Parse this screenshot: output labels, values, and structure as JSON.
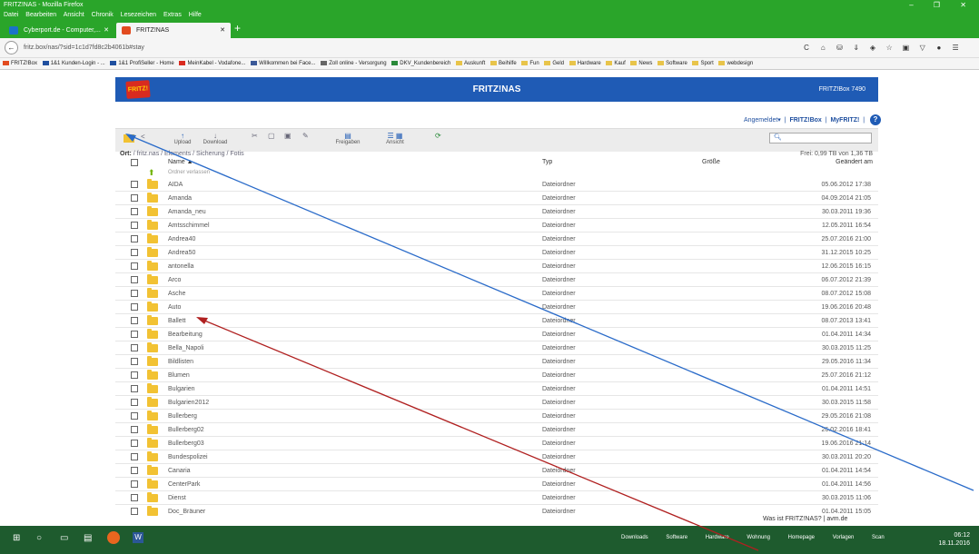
{
  "window": {
    "title": "FRITZ!NAS - Mozilla Firefox",
    "controls": "–  ❐  ✕"
  },
  "menu": [
    "Datei",
    "Bearbeiten",
    "Ansicht",
    "Chronik",
    "Lesezeichen",
    "Extras",
    "Hilfe"
  ],
  "tabs": [
    {
      "label": "Cyberport.de - Computer,...",
      "close": "✕"
    },
    {
      "label": "FRITZ!NAS",
      "close": "✕"
    }
  ],
  "new_tab": "+",
  "nav": {
    "url": "fritz.box/nas/?sid=1c1d7fd8c2b4061b#stay",
    "back": "←",
    "icons": [
      "C",
      "⌂",
      "⛁",
      "⇓",
      "◈",
      "☆",
      "▣",
      "▽",
      "●",
      "☰"
    ]
  },
  "bookmarks": [
    "FRITZ!Box",
    "1&1 Kunden-Login - ...",
    "1&1 ProfiSeller - Home",
    "MeinKabel - Vodafone...",
    "Willkommen bei Face...",
    "Zoll online - Versorgung",
    "DKV_Kundenbereich",
    "Auskunft",
    "Beihilfe",
    "Fun",
    "Geld",
    "Hardware",
    "Kauf",
    "News",
    "Software",
    "Sport",
    "webdesign"
  ],
  "fritz": {
    "logo": "FRITZ!",
    "title": "FRITZ!NAS",
    "model": "FRITZ!Box 7490",
    "links": {
      "logged": "Angemeldet▾",
      "sep": "|",
      "fritzbox": "FRITZ!Box",
      "myfritz": "MyFRITZ!",
      "help": "?"
    }
  },
  "toolbar": {
    "upload": "Upload",
    "download": "Download",
    "freigaben": "Freigaben",
    "ansicht": "Ansicht",
    "search_placeholder": ""
  },
  "path": {
    "label": "Ort:",
    "value": "/ fritz.nas / Elements / Sicherung / Fotis",
    "free": "Frei: 0,99 TB von 1,36 TB"
  },
  "columns": {
    "name": "Name ▲",
    "type": "Typ",
    "size": "Größe",
    "date": "Geändert am"
  },
  "up_label": "Ordner verlassen",
  "rows": [
    {
      "name": "AIDA",
      "type": "Dateiordner",
      "date": "05.06.2012 17:38"
    },
    {
      "name": "Amanda",
      "type": "Dateiordner",
      "date": "04.09.2014 21:05"
    },
    {
      "name": "Amanda_neu",
      "type": "Dateiordner",
      "date": "30.03.2011 19:36"
    },
    {
      "name": "Amtsschimmel",
      "type": "Dateiordner",
      "date": "12.05.2011 16:54"
    },
    {
      "name": "Andrea40",
      "type": "Dateiordner",
      "date": "25.07.2016 21:00"
    },
    {
      "name": "Andrea50",
      "type": "Dateiordner",
      "date": "31.12.2015 10:25"
    },
    {
      "name": "antonella",
      "type": "Dateiordner",
      "date": "12.06.2015 16:15"
    },
    {
      "name": "Arco",
      "type": "Dateiordner",
      "date": "06.07.2012 21:39"
    },
    {
      "name": "Asche",
      "type": "Dateiordner",
      "date": "08.07.2012 15:08"
    },
    {
      "name": "Auto",
      "type": "Dateiordner",
      "date": "19.06.2016 20:48"
    },
    {
      "name": "Ballett",
      "type": "Dateiordner",
      "date": "08.07.2013 13:41"
    },
    {
      "name": "Bearbeitung",
      "type": "Dateiordner",
      "date": "01.04.2011 14:34"
    },
    {
      "name": "Bella_Napoli",
      "type": "Dateiordner",
      "date": "30.03.2015 11:25"
    },
    {
      "name": "Bildlisten",
      "type": "Dateiordner",
      "date": "29.05.2016 11:34"
    },
    {
      "name": "Blumen",
      "type": "Dateiordner",
      "date": "25.07.2016 21:12"
    },
    {
      "name": "Bulgarien",
      "type": "Dateiordner",
      "date": "01.04.2011 14:51"
    },
    {
      "name": "Bulgarien2012",
      "type": "Dateiordner",
      "date": "30.03.2015 11:58"
    },
    {
      "name": "Bullerberg",
      "type": "Dateiordner",
      "date": "29.05.2016 21:08"
    },
    {
      "name": "Bullerberg02",
      "type": "Dateiordner",
      "date": "26.02.2016 18:41"
    },
    {
      "name": "Bullerberg03",
      "type": "Dateiordner",
      "date": "19.06.2016 21:14"
    },
    {
      "name": "Bundespolizei",
      "type": "Dateiordner",
      "date": "30.03.2011 20:20"
    },
    {
      "name": "Canaria",
      "type": "Dateiordner",
      "date": "01.04.2011 14:54"
    },
    {
      "name": "CenterPark",
      "type": "Dateiordner",
      "date": "01.04.2011 14:56"
    },
    {
      "name": "Dienst",
      "type": "Dateiordner",
      "date": "30.03.2015 11:06"
    },
    {
      "name": "Doc_Bräuner",
      "type": "Dateiordner",
      "date": "01.04.2011 15:05"
    }
  ],
  "footer": "Was ist FRITZ!NAS? | avm.de",
  "taskbar": {
    "links": [
      "Downloads",
      "Software",
      "Hardware",
      "Wohnung",
      "Homepage",
      "Vorlagen",
      "Scan"
    ],
    "time": "06:12",
    "date": "18.11.2016"
  },
  "colors": {
    "titlebar": "#2aa52a",
    "fritz_blue": "#1f5bb5",
    "folder": "#f2c233",
    "arrow_blue": "#2a6bc9",
    "arrow_red": "#b02020"
  }
}
